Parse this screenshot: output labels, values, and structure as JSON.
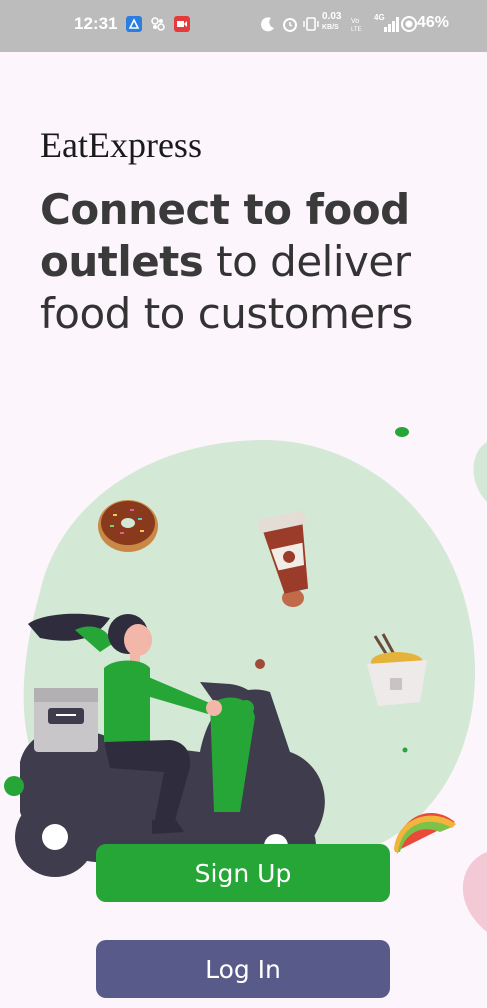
{
  "status_bar": {
    "time": "12:31",
    "battery": "46%",
    "network_speed": "0.03",
    "network_unit": "KB/S",
    "signal_label": "4G",
    "icons": [
      "app-notification-icon",
      "sync-icon",
      "video-recorder-icon",
      "moon-icon",
      "alarm-icon",
      "vibrate-icon",
      "volte-icon",
      "signal-icon",
      "battery-icon"
    ]
  },
  "app": {
    "title": "EatExpress",
    "headline_bold": "Connect to food outlets",
    "headline_rest": " to deliver food to customers"
  },
  "colors": {
    "brand_green": "#27a638",
    "login_purple": "#585a8a",
    "blob_green": "#d3e9d6"
  },
  "actions": {
    "signup_label": "Sign Up",
    "login_label": "Log In"
  }
}
